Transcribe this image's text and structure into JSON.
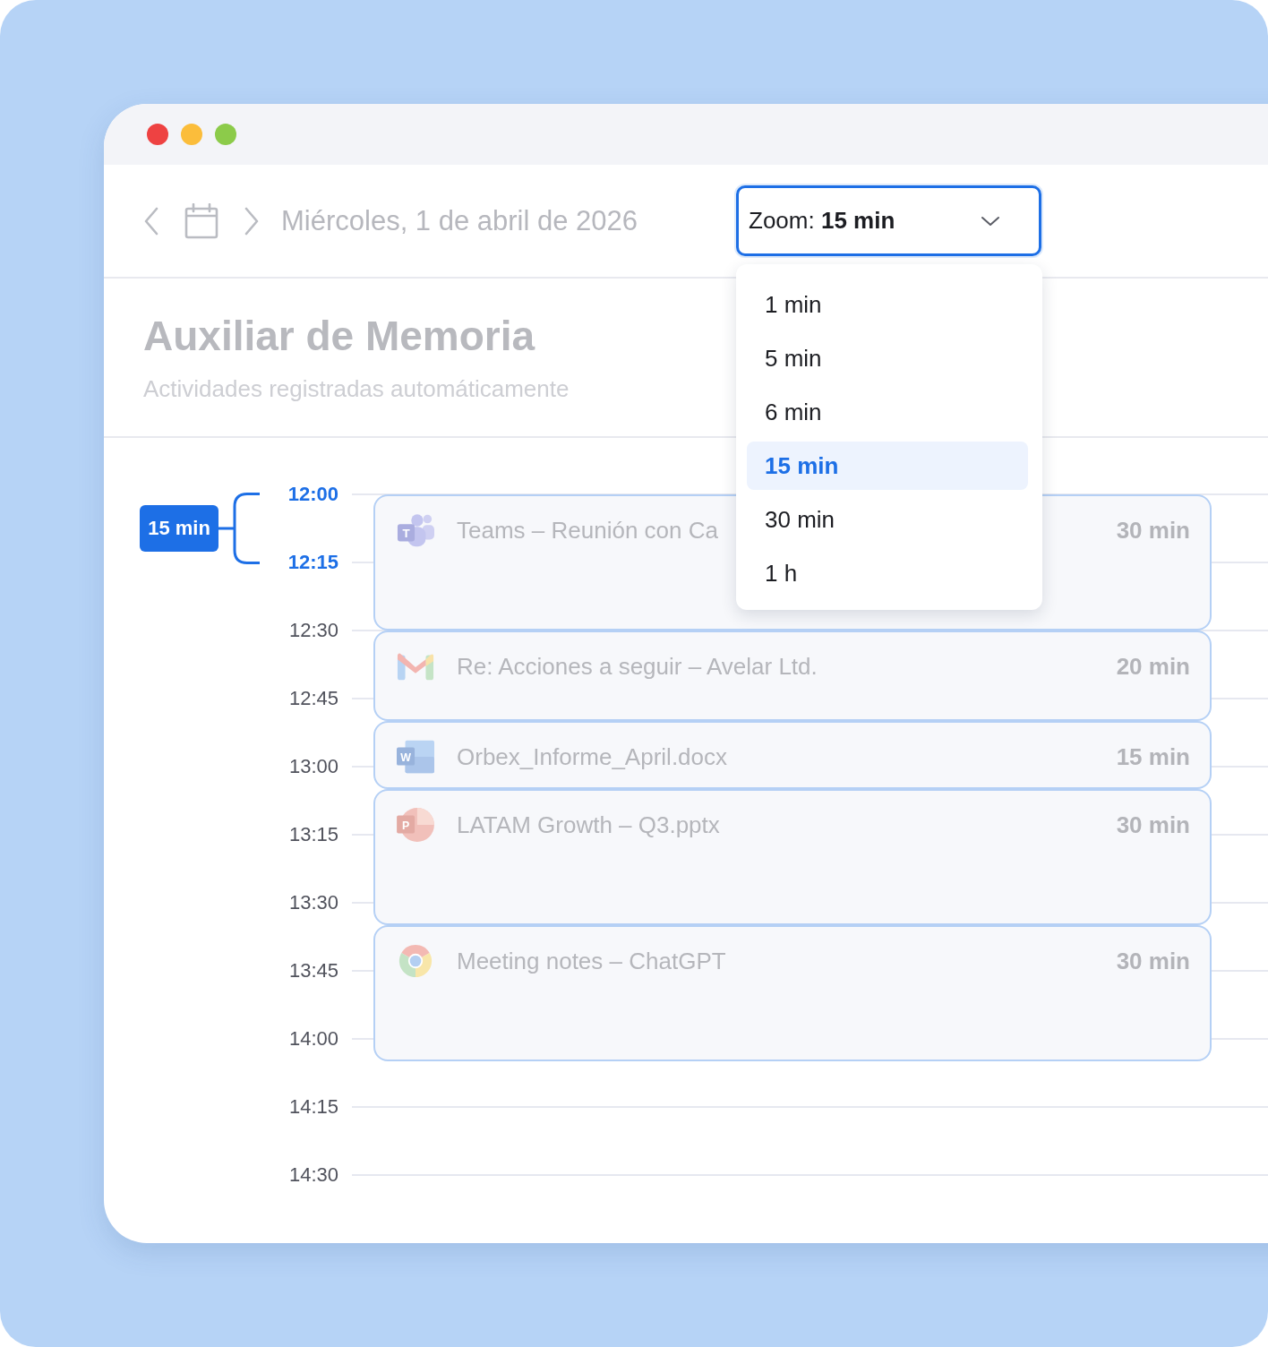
{
  "window": {
    "controls": [
      {
        "color": "#ee4242"
      },
      {
        "color": "#fbbd3b"
      },
      {
        "color": "#8ccb4a"
      }
    ]
  },
  "toolbar": {
    "date": "Miércoles, 1 de abril de 2026",
    "zoom_select": {
      "value": "Zoom: **15 min**",
      "expanded": true,
      "options": [
        {
          "label": "1 min",
          "selected": false
        },
        {
          "label": "5 min",
          "selected": false
        },
        {
          "label": "6 min",
          "selected": false
        },
        {
          "label": "15 min",
          "selected": true
        },
        {
          "label": "30 min",
          "selected": false
        },
        {
          "label": "1 h",
          "selected": false
        }
      ]
    }
  },
  "header": {
    "title": "Auxiliar de Memoria",
    "subtitle": "Actividades registradas automáticamente"
  },
  "timeline": {
    "interval_badge": "15 min",
    "times": [
      {
        "label": "12:00",
        "highlighted": true
      },
      {
        "label": "12:15",
        "highlighted": true
      },
      {
        "label": "12:30",
        "highlighted": false
      },
      {
        "label": "12:45",
        "highlighted": false
      },
      {
        "label": "13:00",
        "highlighted": false
      },
      {
        "label": "13:15",
        "highlighted": false
      },
      {
        "label": "13:30",
        "highlighted": false
      },
      {
        "label": "13:45",
        "highlighted": false
      },
      {
        "label": "14:00",
        "highlighted": false
      },
      {
        "label": "14:15",
        "highlighted": false
      },
      {
        "label": "14:30",
        "highlighted": false
      }
    ],
    "events": [
      {
        "kind": "people",
        "icon_letter": "T",
        "title": "Teams – Reunión con Ca",
        "duration": "30 min"
      },
      {
        "kind": "mail",
        "title": "Re: Acciones a seguir – Avelar Ltd.",
        "duration": "20 min"
      },
      {
        "kind": "document",
        "icon_letter": "W",
        "title": "Orbex_Informe_April.docx",
        "duration": "15 min"
      },
      {
        "kind": "slides",
        "icon_letter": "P",
        "title": "LATAM Growth – Q3.pptx",
        "duration": "30 min"
      },
      {
        "kind": "browser",
        "title": "Meeting notes – ChatGPT",
        "duration": "30 min"
      }
    ]
  }
}
